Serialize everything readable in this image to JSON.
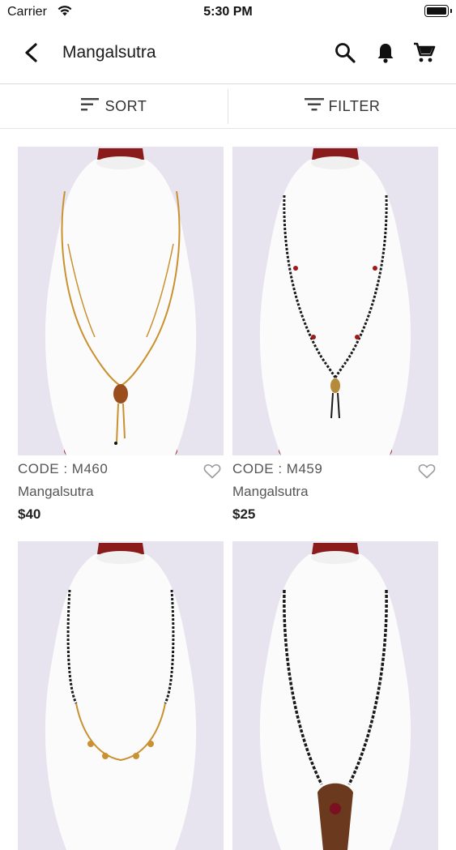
{
  "status_bar": {
    "carrier": "Carrier",
    "time": "5:30 PM"
  },
  "header": {
    "title": "Mangalsutra"
  },
  "toolbar": {
    "sort_label": "SORT",
    "filter_label": "FILTER"
  },
  "products": [
    {
      "code": "CODE : M460",
      "name": "Mangalsutra",
      "price": "$40",
      "chain": "gold"
    },
    {
      "code": "CODE : M459",
      "name": "Mangalsutra",
      "price": "$25",
      "chain": "black-bead"
    },
    {
      "code": "",
      "name": "",
      "price": "",
      "chain": "black-gold"
    },
    {
      "code": "",
      "name": "",
      "price": "",
      "chain": "black-pendant"
    }
  ]
}
